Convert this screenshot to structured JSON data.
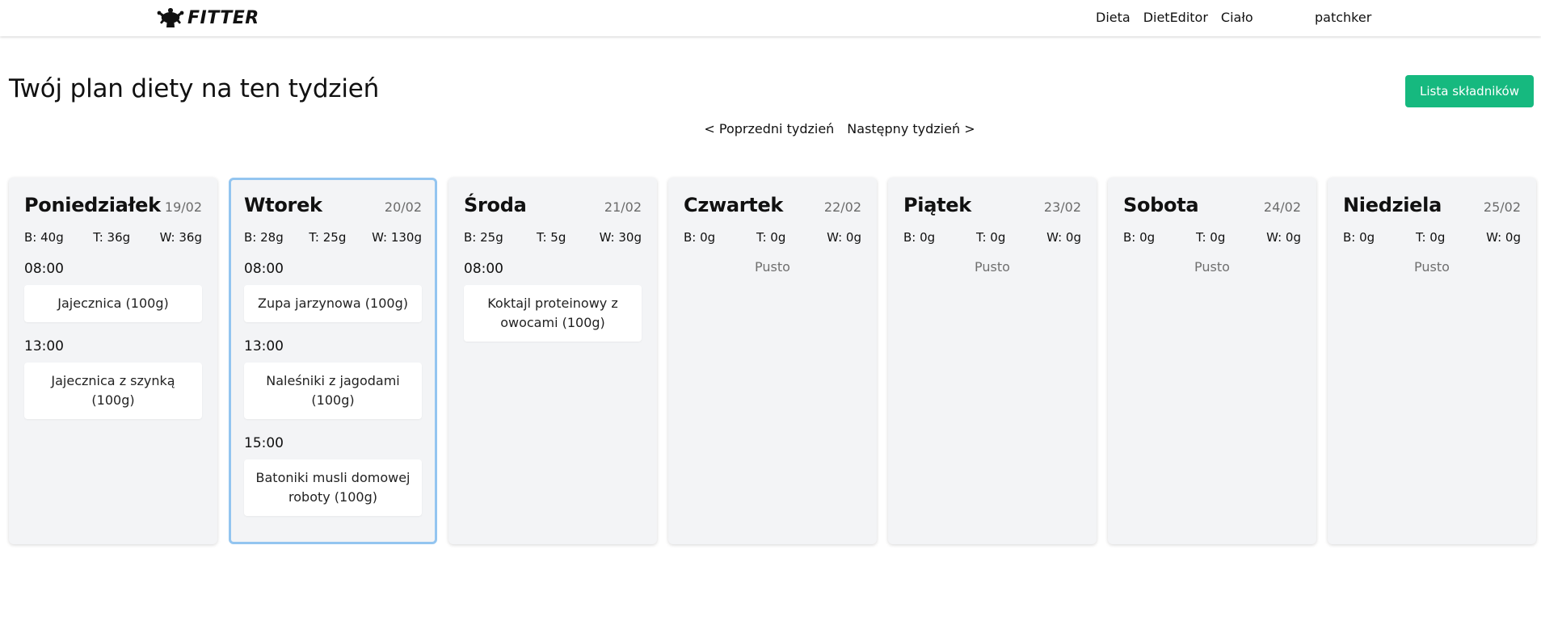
{
  "header": {
    "logo_text": "FITTER",
    "logo_icon": "muscle-man-icon",
    "nav": [
      "Dieta",
      "DietEditor",
      "Ciało"
    ],
    "user": "patchker"
  },
  "page": {
    "title": "Twój plan diety na ten tydzień",
    "ingredients_button": "Lista składników",
    "prev_week": "< Poprzedni tydzień",
    "next_week": "Następny tydzień >"
  },
  "colors": {
    "accent": "#16b97f",
    "selected_border": "#93c5f0",
    "card_bg": "#f3f4f6"
  },
  "days": [
    {
      "name": "Poniedziałek",
      "date": "19/02",
      "macros": [
        "B: 40g",
        "T: 36g",
        "W: 36g"
      ],
      "selected": false,
      "meals": [
        {
          "time": "08:00",
          "dish": "Jajecznica (100g)"
        },
        {
          "time": "13:00",
          "dish": "Jajecznica z szynką (100g)"
        }
      ],
      "empty": ""
    },
    {
      "name": "Wtorek",
      "date": "20/02",
      "macros": [
        "B: 28g",
        "T: 25g",
        "W: 130g"
      ],
      "selected": true,
      "meals": [
        {
          "time": "08:00",
          "dish": "Zupa jarzynowa (100g)"
        },
        {
          "time": "13:00",
          "dish": "Naleśniki z jagodami (100g)"
        },
        {
          "time": "15:00",
          "dish": "Batoniki musli domowej roboty (100g)"
        }
      ],
      "empty": ""
    },
    {
      "name": "Środa",
      "date": "21/02",
      "macros": [
        "B: 25g",
        "T: 5g",
        "W: 30g"
      ],
      "selected": false,
      "meals": [
        {
          "time": "08:00",
          "dish": "Koktajl proteinowy z owocami (100g)"
        }
      ],
      "empty": ""
    },
    {
      "name": "Czwartek",
      "date": "22/02",
      "macros": [
        "B: 0g",
        "T: 0g",
        "W: 0g"
      ],
      "selected": false,
      "meals": [],
      "empty": "Pusto"
    },
    {
      "name": "Piątek",
      "date": "23/02",
      "macros": [
        "B: 0g",
        "T: 0g",
        "W: 0g"
      ],
      "selected": false,
      "meals": [],
      "empty": "Pusto"
    },
    {
      "name": "Sobota",
      "date": "24/02",
      "macros": [
        "B: 0g",
        "T: 0g",
        "W: 0g"
      ],
      "selected": false,
      "meals": [],
      "empty": "Pusto"
    },
    {
      "name": "Niedziela",
      "date": "25/02",
      "macros": [
        "B: 0g",
        "T: 0g",
        "W: 0g"
      ],
      "selected": false,
      "meals": [],
      "empty": "Pusto"
    }
  ]
}
